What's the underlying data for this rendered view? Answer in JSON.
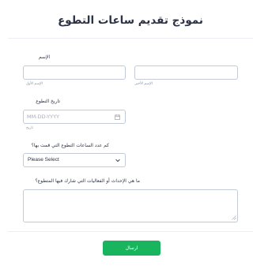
{
  "form": {
    "title": "نموذج تقديم ساعات التطوع",
    "submit_label": "ارسال"
  },
  "name_field": {
    "label": "الإسم",
    "first_value": "",
    "last_value": "",
    "first_sublabel": "الإسم الأول",
    "last_sublabel": "الإسم الأخير"
  },
  "date_field": {
    "label": "تاريخ التطوع",
    "placeholder": "MM-DD-YYYY",
    "sublabel": "تاريخ",
    "icon": "calendar-icon"
  },
  "hours_field": {
    "label": "كم عدد الساعات التطوع التي قمت بها؟",
    "selected": "Please Select",
    "icon": "chevron-down-icon"
  },
  "events_field": {
    "label": "ما هي الإحداث أو الفعاليات التي شارك فيها المتطوع؟",
    "value": ""
  },
  "colors": {
    "accent": "#18b55e",
    "border": "#c3cad8",
    "text": "#2c3345"
  }
}
